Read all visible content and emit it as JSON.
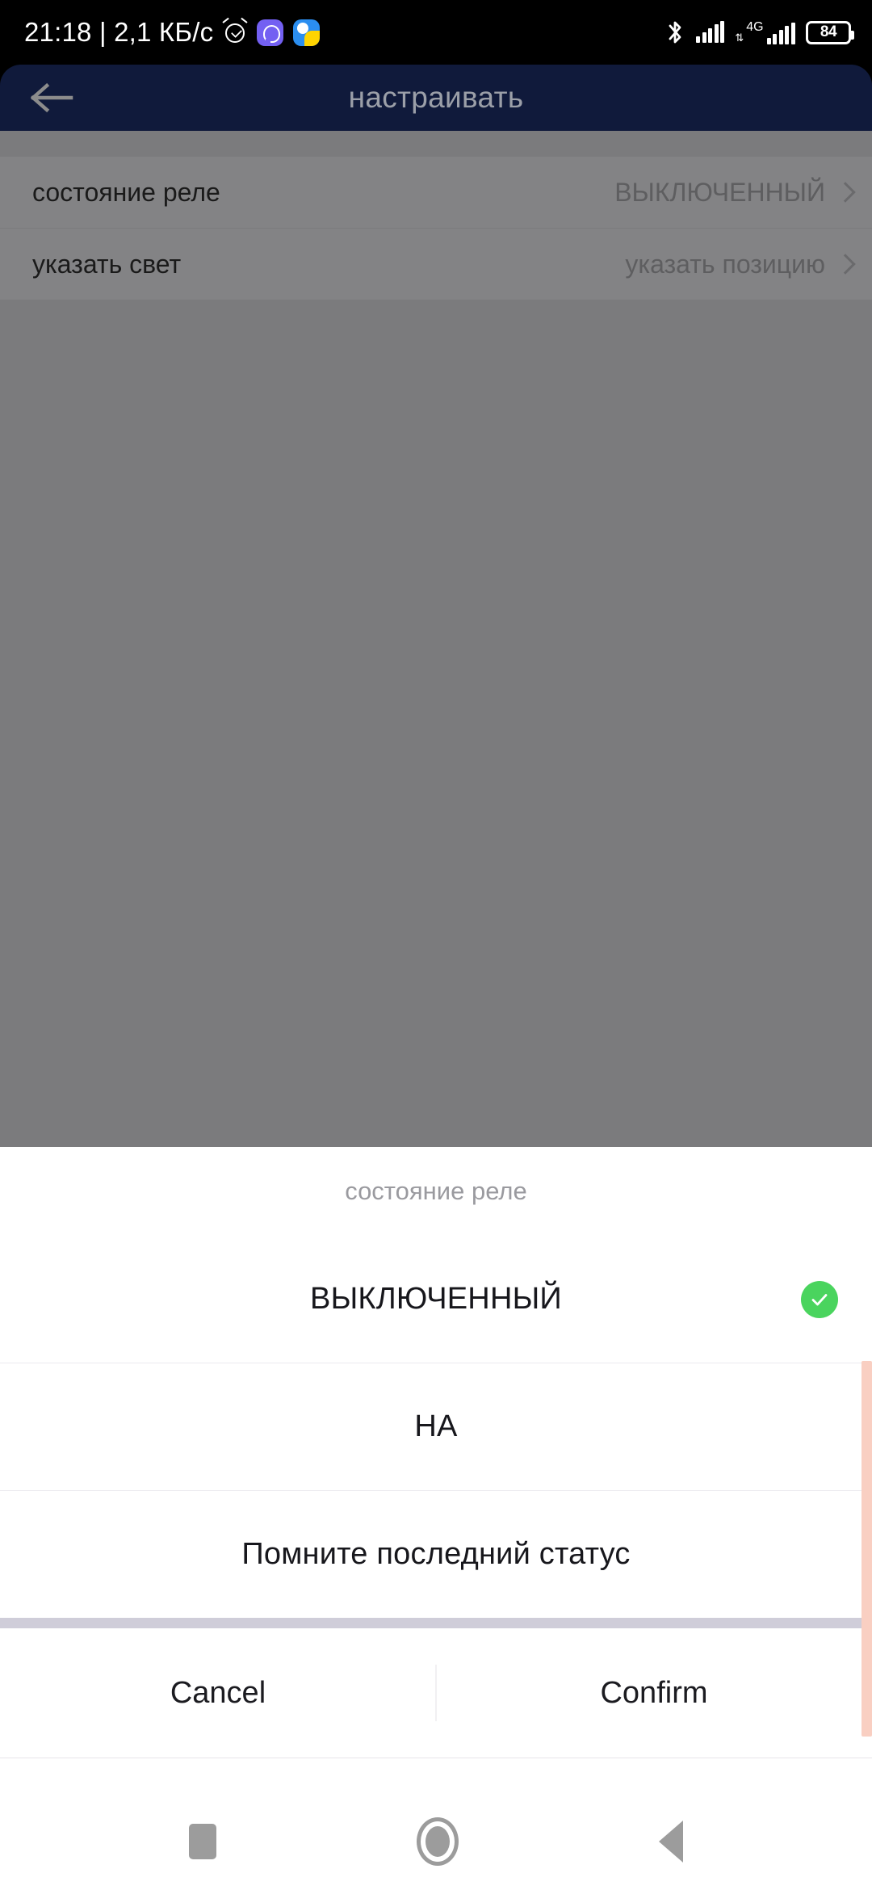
{
  "status_bar": {
    "time": "21:18",
    "separator": "|",
    "network_speed": "2,1 КБ/с",
    "clock_text": "21:18 | 2,1 КБ/с",
    "left_icons": [
      "alarm-icon",
      "viber-icon",
      "diia-icon"
    ],
    "right_icons": [
      "bluetooth-icon",
      "signal-bars-icon",
      "signal-bars-icon-2"
    ],
    "network_type": "4G",
    "data_arrows": "⇅",
    "battery_level": "84"
  },
  "app_bar": {
    "title": "настраивать",
    "back_icon": "back-arrow-icon",
    "background_color": "#101a3b",
    "title_color": "#9b9fa8"
  },
  "settings_list": {
    "rows": [
      {
        "label": "состояние реле",
        "value": "ВЫКЛЮЧЕННЫЙ",
        "chevron": "chevron-right-icon"
      },
      {
        "label": "указать свет",
        "value": "указать позицию",
        "chevron": "chevron-right-icon"
      }
    ]
  },
  "bottom_sheet": {
    "title": "состояние реле",
    "options": [
      {
        "label": "ВЫКЛЮЧЕННЫЙ",
        "selected": true
      },
      {
        "label": "НА",
        "selected": false
      },
      {
        "label": "Помните последний статус",
        "selected": false
      }
    ],
    "selected_check_icon": "check-circle-icon",
    "selected_color": "#4ad45e",
    "scrollbar_color": "#f9cfc2",
    "cancel_label": "Cancel",
    "confirm_label": "Confirm"
  },
  "nav_bar": {
    "recents_icon": "square-recents-icon",
    "home_icon": "circle-home-icon",
    "back_icon": "triangle-back-icon"
  }
}
